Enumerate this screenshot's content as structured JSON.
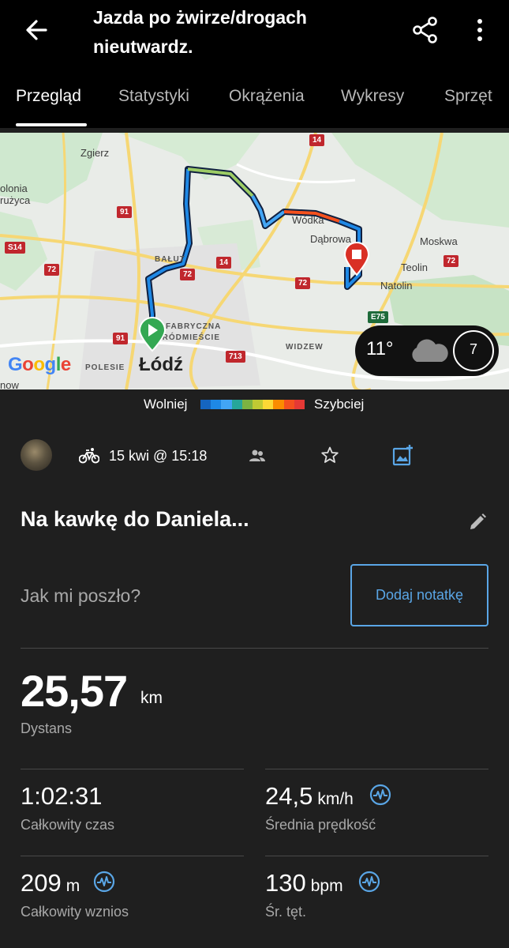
{
  "header": {
    "title": "Jazda po żwirze/drogach nieutwardz."
  },
  "tabs": [
    {
      "label": "Przegląd"
    },
    {
      "label": "Statystyki"
    },
    {
      "label": "Okrążenia"
    },
    {
      "label": "Wykresy"
    },
    {
      "label": "Sprzęt"
    }
  ],
  "map": {
    "labels": {
      "zgierz": "Zgierz",
      "colonia": "olonia",
      "truzyca": "rużyca",
      "baluty": "BAŁUT",
      "fabryczna": "FABRYCZNA",
      "srodmiescie": "ŚRÓDMIEŚCIE",
      "lodz": "Łódź",
      "polesie": "POLESIE",
      "widzew": "WIDZEW",
      "wodka": "Wódka",
      "dabrowa": "Dąbrowa",
      "moskwa": "Moskwa",
      "teolin": "Teolin",
      "natolin": "Natolin",
      "now": "now",
      "google": "Google"
    },
    "roads": [
      "14",
      "91",
      "S14",
      "72",
      "14",
      "72",
      "72",
      "72",
      "91",
      "713",
      "E75"
    ],
    "weather": {
      "temp": "11°",
      "wind": "7"
    }
  },
  "legend": {
    "slow": "Wolniej",
    "fast": "Szybciej",
    "colors": [
      "#1565c0",
      "#1e88e5",
      "#42a5f5",
      "#26a69a",
      "#7cb342",
      "#c0ca33",
      "#fdd835",
      "#fb8c00",
      "#f4511e",
      "#e53935"
    ]
  },
  "activity": {
    "datetime": "15 kwi @ 15:18",
    "name": "Na kawkę do Daniela...",
    "prompt": "Jak mi poszło?",
    "note_button": "Dodaj notatkę"
  },
  "distance": {
    "value": "25,57",
    "unit": "km",
    "label": "Dystans"
  },
  "stats": {
    "total_time": {
      "value": "1:02:31",
      "unit": "",
      "label": "Całkowity czas"
    },
    "avg_speed": {
      "value": "24,5",
      "unit": "km/h",
      "label": "Średnia prędkość"
    },
    "elevation": {
      "value": "209",
      "unit": "m",
      "label": "Całkowity wznios"
    },
    "avg_hr": {
      "value": "130",
      "unit": "bpm",
      "label": "Śr. tęt."
    }
  },
  "colors": {
    "accent": "#5aa6e6",
    "background": "#1f1f1f",
    "start_marker": "#34a853",
    "end_marker": "#d93025"
  }
}
